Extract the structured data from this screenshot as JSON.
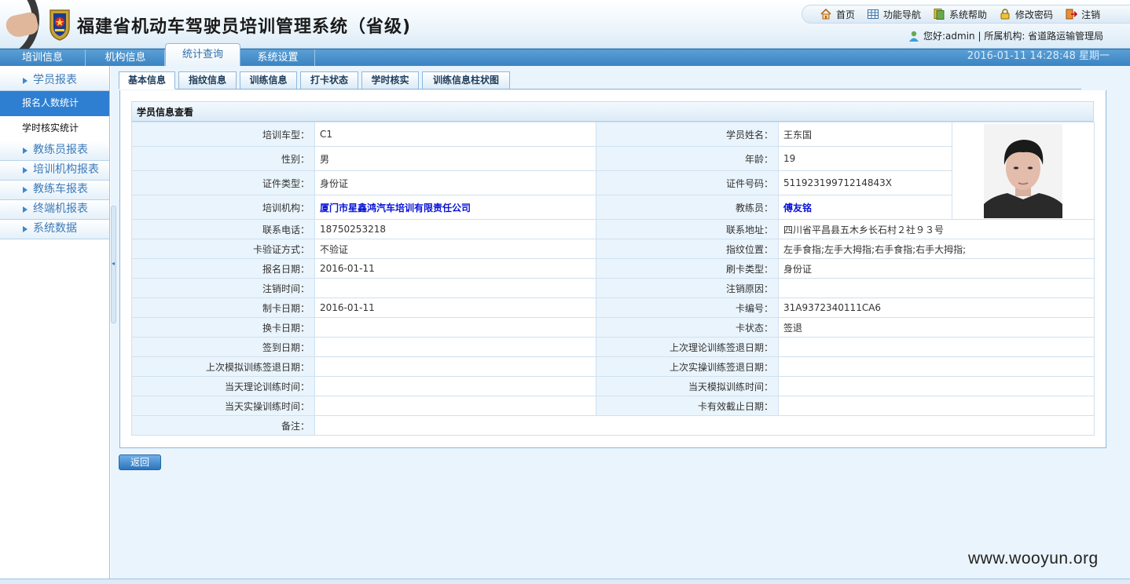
{
  "header": {
    "title": "福建省机动车驾驶员培训管理系统（省级)",
    "links": {
      "home": "首页",
      "nav": "功能导航",
      "help": "系统帮助",
      "password": "修改密码",
      "logout": "注销"
    },
    "user_line": "您好:admin | 所属机构: 省道路运输管理局"
  },
  "nav": {
    "tabs": [
      "培训信息",
      "机构信息",
      "统计查询",
      "系统设置"
    ],
    "active": "统计查询",
    "datetime": "2016-01-11 14:28:48 星期一"
  },
  "sidebar": {
    "group1": "学员报表",
    "sub1": "报名人数统计",
    "sub2": "学时核实统计",
    "groups": [
      "教练员报表",
      "培训机构报表",
      "教练车报表",
      "终端机报表",
      "系统数据"
    ]
  },
  "subtabs": [
    "基本信息",
    "指纹信息",
    "训练信息",
    "打卡状态",
    "学时核实",
    "训练信息柱状图"
  ],
  "panel": {
    "title": "学员信息查看",
    "rows": [
      [
        "培训车型：",
        "C1",
        "学员姓名：",
        "王东国"
      ],
      [
        "性别：",
        "男",
        "年龄：",
        "19"
      ],
      [
        "证件类型：",
        "身份证",
        "证件号码：",
        "51192319971214843X"
      ],
      [
        "培训机构：",
        "厦门市星鑫鸿汽车培训有限责任公司",
        "教练员：",
        "傅友铭"
      ],
      [
        "联系电话：",
        "18750253218",
        "联系地址：",
        "四川省平昌县五木乡长石村２社９３号"
      ],
      [
        "卡验证方式：",
        "不验证",
        "指纹位置：",
        "左手食指;左手大拇指;右手食指;右手大拇指;"
      ],
      [
        "报名日期：",
        "2016-01-11",
        "刷卡类型：",
        "身份证"
      ],
      [
        "注销时间：",
        "",
        "注销原因：",
        ""
      ],
      [
        "制卡日期：",
        "2016-01-11",
        "卡编号：",
        "31A9372340111CA6"
      ],
      [
        "换卡日期：",
        "",
        "卡状态：",
        "签退"
      ],
      [
        "签到日期：",
        "",
        "上次理论训练签退日期：",
        ""
      ],
      [
        "上次模拟训练签退日期：",
        "",
        "上次实操训练签退日期：",
        ""
      ],
      [
        "当天理论训练时间：",
        "",
        "当天模拟训练时间：",
        ""
      ],
      [
        "当天实操训练时间：",
        "",
        "卡有效截止日期：",
        ""
      ]
    ],
    "remark_label": "备注："
  },
  "back_button": "返回",
  "watermark": "www.wooyun.org"
}
